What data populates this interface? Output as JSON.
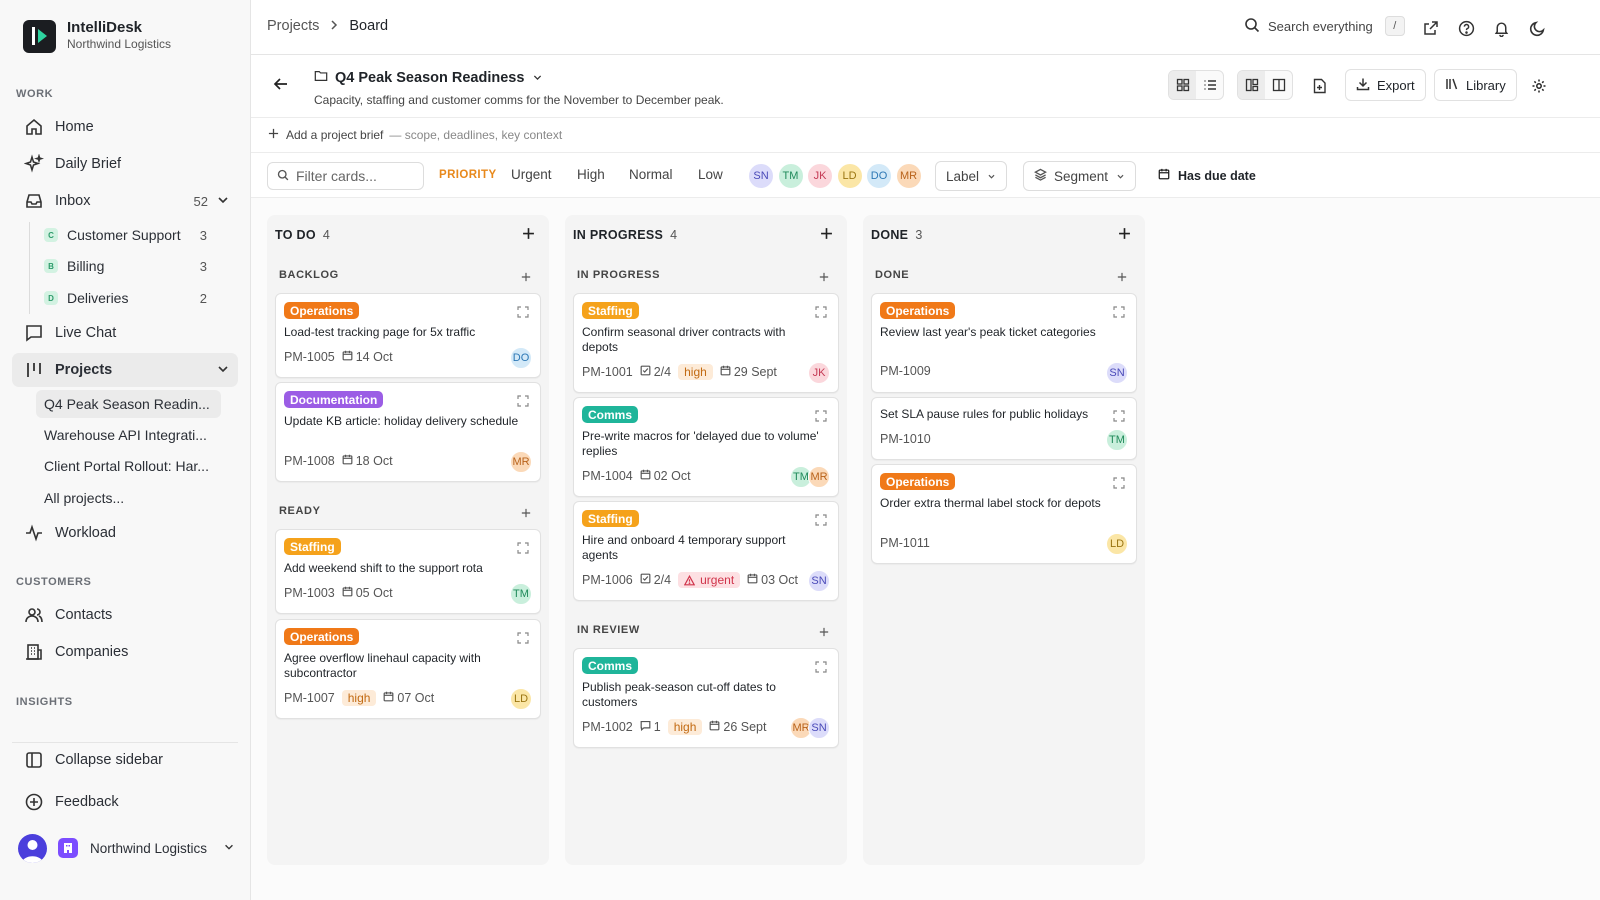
{
  "brand": {
    "name": "IntelliDesk",
    "org": "Northwind Logistics"
  },
  "sidebar": {
    "work_label": "WORK",
    "items": {
      "home": "Home",
      "daily_brief": "Daily Brief",
      "inbox": "Inbox",
      "inbox_count": "52",
      "live_chat": "Live Chat",
      "projects": "Projects",
      "workload": "Workload"
    },
    "inbox_sub": [
      {
        "badge": "C",
        "label": "Customer Support",
        "count": "3"
      },
      {
        "badge": "B",
        "label": "Billing",
        "count": "3"
      },
      {
        "badge": "D",
        "label": "Deliveries",
        "count": "2"
      }
    ],
    "projects_sub": [
      "Q4 Peak Season Readin...",
      "Warehouse API Integrati...",
      "Client Portal Rollout: Har...",
      "All projects..."
    ],
    "customers_label": "CUSTOMERS",
    "contacts": "Contacts",
    "companies": "Companies",
    "insights_label": "INSIGHTS",
    "collapse": "Collapse sidebar",
    "feedback": "Feedback",
    "org_switch": "Northwind Logistics"
  },
  "topbar": {
    "breadcrumb_root": "Projects",
    "breadcrumb_current": "Board",
    "search_label": "Search everything",
    "search_kbd": "/"
  },
  "project": {
    "title": "Q4 Peak Season Readiness",
    "description": "Capacity, staffing and customer comms for the November to December peak.",
    "export_label": "Export",
    "library_label": "Library",
    "brief_action": "Add a project brief",
    "brief_hint": "— scope, deadlines, key context"
  },
  "filters": {
    "placeholder": "Filter cards...",
    "priority_label": "PRIORITY",
    "priorities": [
      "Urgent",
      "High",
      "Normal",
      "Low"
    ],
    "assignees": [
      "SN",
      "TM",
      "JK",
      "LD",
      "DO",
      "MR"
    ],
    "label_dd": "Label",
    "segment_dd": "Segment",
    "due_label": "Has due date"
  },
  "colors": {
    "operations": "#f07918",
    "documentation": "#9b5de5",
    "staffing": "#f5a21b",
    "comms": "#1fb59a",
    "avatar_SN": "#dcdcfa",
    "avatar_TM": "#c9efdc",
    "avatar_JK": "#fbd7dc",
    "avatar_LD": "#fbe6a6",
    "avatar_DO": "#d3e9f8",
    "avatar_MR": "#fbd9b8"
  },
  "board": {
    "columns": [
      {
        "title": "TO DO",
        "count": "4",
        "groups": [
          {
            "name": "BACKLOG",
            "cards": [
              {
                "label": "Operations",
                "title": "Load-test tracking page for 5x traffic",
                "id": "PM-1005",
                "due": "14 Oct",
                "avatars": [
                  "DO"
                ]
              },
              {
                "label": "Documentation",
                "title": "Update KB article: holiday delivery schedule",
                "id": "PM-1008",
                "due": "18 Oct",
                "avatars": [
                  "MR"
                ]
              }
            ]
          },
          {
            "name": "READY",
            "cards": [
              {
                "label": "Staffing",
                "title": "Add weekend shift to the support rota",
                "id": "PM-1003",
                "due": "05 Oct",
                "avatars": [
                  "TM"
                ]
              },
              {
                "label": "Operations",
                "title": "Agree overflow linehaul capacity with subcontractor",
                "id": "PM-1007",
                "priority": "high",
                "due": "07 Oct",
                "avatars": [
                  "LD"
                ]
              }
            ]
          }
        ]
      },
      {
        "title": "IN PROGRESS",
        "count": "4",
        "groups": [
          {
            "name": "IN PROGRESS",
            "cards": [
              {
                "label": "Staffing",
                "title": "Confirm seasonal driver contracts with depots",
                "id": "PM-1001",
                "checklist": "2/4",
                "priority": "high",
                "due": "29 Sept",
                "avatars": [
                  "JK"
                ]
              },
              {
                "label": "Comms",
                "title": "Pre-write macros for 'delayed due to volume' replies",
                "id": "PM-1004",
                "due": "02 Oct",
                "avatars": [
                  "TM",
                  "MR"
                ]
              },
              {
                "label": "Staffing",
                "title": "Hire and onboard 4 temporary support agents",
                "id": "PM-1006",
                "checklist": "2/4",
                "priority": "urgent",
                "due": "03 Oct",
                "avatars": [
                  "SN"
                ]
              }
            ]
          },
          {
            "name": "IN REVIEW",
            "cards": [
              {
                "label": "Comms",
                "title": "Publish peak-season cut-off dates to customers",
                "id": "PM-1002",
                "comments": "1",
                "priority": "high",
                "due": "26 Sept",
                "avatars": [
                  "MR",
                  "SN"
                ]
              }
            ]
          }
        ]
      },
      {
        "title": "DONE",
        "count": "3",
        "groups": [
          {
            "name": "DONE",
            "cards": [
              {
                "label": "Operations",
                "title": "Review last year's peak ticket categories",
                "id": "PM-1009",
                "avatars": [
                  "SN"
                ]
              },
              {
                "title": "Set SLA pause rules for public holidays",
                "id": "PM-1010",
                "avatars": [
                  "TM"
                ]
              },
              {
                "label": "Operations",
                "title": "Order extra thermal label stock for depots",
                "id": "PM-1011",
                "avatars": [
                  "LD"
                ]
              }
            ]
          }
        ]
      }
    ]
  }
}
